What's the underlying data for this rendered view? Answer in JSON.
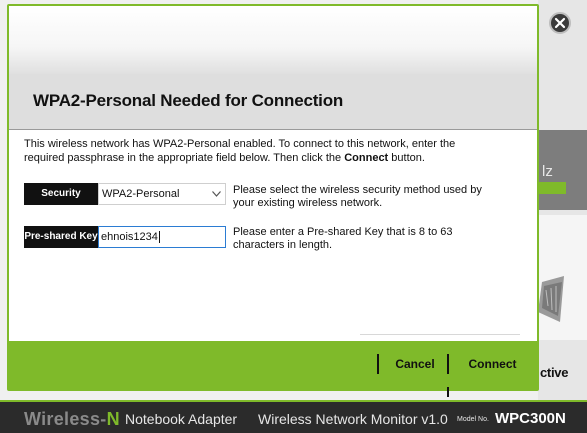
{
  "background_app": {
    "stray_label": "lz",
    "active_label": "ctive"
  },
  "dialog": {
    "title": "WPA2-Personal Needed for Connection",
    "intro_part1": "This wireless network has WPA2-Personal enabled. To connect to this network, enter the required passphrase in the appropriate field below. Then click the ",
    "intro_bold": "Connect",
    "intro_part2": " button.",
    "security": {
      "label": "Security",
      "selected": "WPA2-Personal",
      "help": "Please select the wireless security method used by your existing wireless network."
    },
    "psk": {
      "label": "Pre-shared Key",
      "value": "ehnois1234",
      "help": "Please enter a Pre-shared Key that is 8 to 63 characters in length."
    },
    "buttons": {
      "cancel": "Cancel",
      "connect": "Connect"
    }
  },
  "brand_bar": {
    "wireless": "Wireless-",
    "n": "N",
    "adapter": "Notebook Adapter",
    "monitor": "Wireless Network Monitor  v1.0",
    "model_no_label": "Model No.",
    "model": "WPC300N"
  },
  "colors": {
    "accent_green": "#7fba2a",
    "dark_bar": "#2b2b2b",
    "label_black": "#111111"
  },
  "icons": {
    "close": "close-icon",
    "dropdown": "chevron-down-icon"
  }
}
